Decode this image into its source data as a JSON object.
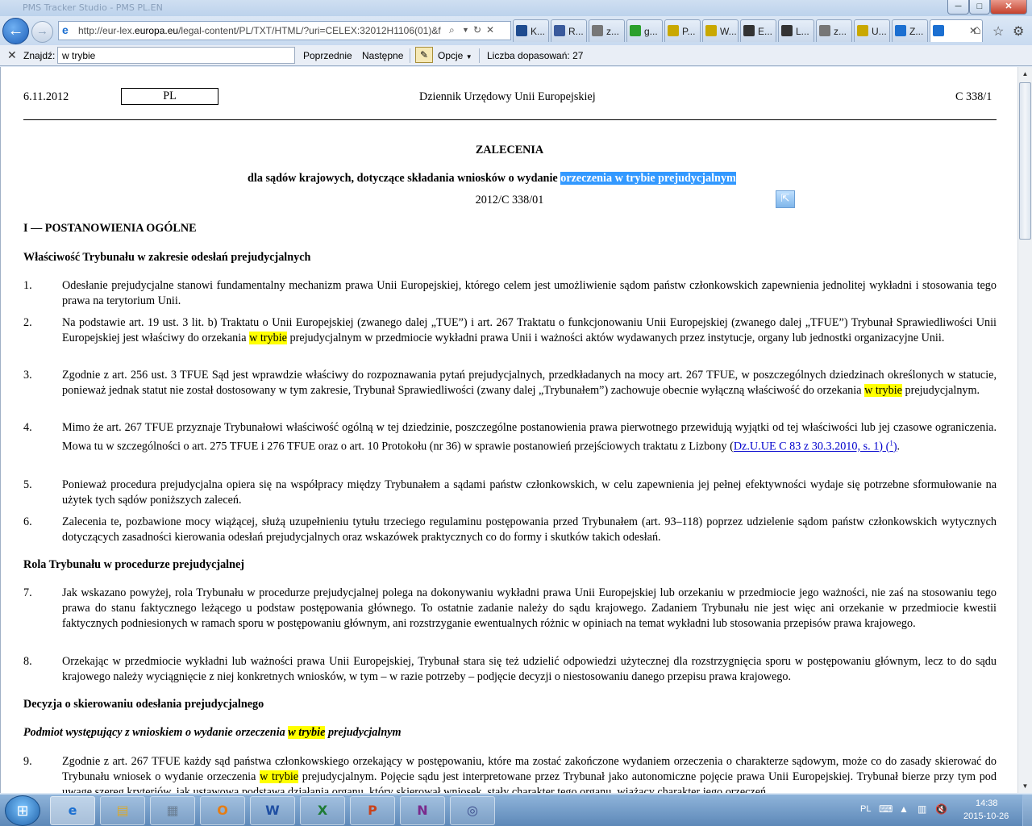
{
  "window": {
    "title": "PMS Tracker Studio - PMS PL.EN",
    "minimize": "─",
    "maximize": "□",
    "close": "✕"
  },
  "nav": {
    "back_icon": "←",
    "forward_icon": "→",
    "address": "http://eur-lex.europa.eu/legal-content/PL/TXT/HTML/?uri=CELEX:32012H1106(01)&f",
    "address_domain": "europa.eu",
    "tabs": [
      {
        "label": "K...",
        "icon_color": "#1e4b8f"
      },
      {
        "label": "R...",
        "icon_color": "#3a5a9c"
      },
      {
        "label": "z...",
        "icon_color": "#777777"
      },
      {
        "label": "g...",
        "icon_color": "#2ca02c"
      },
      {
        "label": "P...",
        "icon_color": "#c9a800"
      },
      {
        "label": "W...",
        "icon_color": "#c9a800"
      },
      {
        "label": "E...",
        "icon_color": "#333333"
      },
      {
        "label": "L...",
        "icon_color": "#333333"
      },
      {
        "label": "z...",
        "icon_color": "#777777"
      },
      {
        "label": "U...",
        "icon_color": "#c9a800"
      },
      {
        "label": "Z...",
        "icon_color": "#1b6fd1"
      },
      {
        "label": "",
        "icon_color": "#1b6fd1"
      }
    ],
    "home_icon": "⌂",
    "favorites_icon": "☆",
    "tools_icon": "⚙"
  },
  "findbar": {
    "close_icon": "✕",
    "label": "Znajdź:",
    "query": "w trybie",
    "prev": "Poprzednie",
    "next": "Następne",
    "options": "Opcje",
    "matches": "Liczba dopasowań: 27"
  },
  "doc": {
    "date": "6.11.2012",
    "lang": "PL",
    "journal": "Dziennik Urzędowy Unii Europejskiej",
    "number": "C 338/1",
    "title": "ZALECENIA",
    "subtitle_plain": "dla sądów krajowych, dotyczące składania wniosków o wydanie ",
    "subtitle_highlight": "orzeczenia w trybie prejudycjalnym",
    "ref": "2012/C 338/01",
    "section_i": "I —   POSTANOWIENIA OGÓLNE",
    "sub1": "Właściwość Trybunału w zakresie odesłań prejudycjalnych",
    "p1": "Odesłanie prejudycjalne stanowi fundamentalny mechanizm prawa Unii Europejskiej, którego celem jest umożliwienie sądom państw członkowskich zapewnienia jednolitej wykładni i stosowania tego prawa na terytorium Unii.",
    "p2a": "Na podstawie art. 19 ust. 3 lit. b) Traktatu o Unii Europejskiej (zwanego dalej „TUE”) i art. 267 Traktatu o funkcjonowaniu Unii Europejskiej (zwanego dalej „TFUE”) Trybunał Sprawiedliwości Unii Europejskiej jest właściwy do orzekania ",
    "p2hl": "w trybie",
    "p2b": " prejudycjalnym w przedmiocie wykładni prawa Unii i ważności aktów wydawanych przez instytucje, organy lub jednostki organizacyjne Unii.",
    "p3a": "Zgodnie z art. 256 ust. 3 TFUE Sąd jest wprawdzie właściwy do rozpoznawania pytań prejudycjalnych, przedkładanych na mocy art. 267 TFUE, w poszczególnych dziedzinach określonych w statucie, ponieważ jednak statut nie został dostosowany w tym zakresie, Trybunał Sprawiedliwości (zwany dalej „Trybunałem”) zachowuje obecnie wyłączną właściwość do orzekania ",
    "p3hl": "w trybie",
    "p3b": " prejudycjalnym.",
    "p4a": "Mimo że art. 267 TFUE przyznaje Trybunałowi właściwość ogólną w tej dziedzinie, poszczególne postanowienia prawa pierwotnego przewidują wyjątki od tej właściwości lub jej czasowe ograniczenia. Mowa tu w szczególności o art. 275 TFUE i 276 TFUE oraz o art. 10 Protokołu (nr 36) w sprawie postanowień przejściowych traktatu z Lizbony (",
    "p4link": "Dz.U.UE C 83 z 30.3.2010, s. 1",
    "p4b": ") ",
    "p4note": "1",
    "p4c": ".",
    "p5": "Ponieważ procedura prejudycjalna opiera się na współpracy między Trybunałem a sądami państw członkowskich, w celu zapewnienia jej pełnej efektywności wydaje się potrzebne sformułowanie na użytek tych sądów poniższych zaleceń.",
    "p6": "Zalecenia te, pozbawione mocy wiążącej, służą uzupełnieniu tytułu trzeciego regulaminu postępowania przed Trybunałem (art. 93–118) poprzez udzielenie sądom państw członkowskich wytycznych dotyczących zasadności kierowania odesłań prejudycjalnych oraz wskazówek praktycznych co do formy i skutków takich odesłań.",
    "sub2": "Rola Trybunału w procedurze prejudycjalnej",
    "p7": "Jak wskazano powyżej, rola Trybunału w procedurze prejudycjalnej polega na dokonywaniu wykładni prawa Unii Europejskiej lub orzekaniu w przedmiocie jego ważności, nie zaś na stosowaniu tego prawa do stanu faktycznego leżącego u podstaw postępowania głównego. To ostatnie zadanie należy do sądu krajowego. Zadaniem Trybunału nie jest więc ani orzekanie w przedmiocie kwestii faktycznych podniesionych w ramach sporu w postępowaniu głównym, ani rozstrzyganie ewentualnych różnic w opiniach na temat wykładni lub stosowania przepisów prawa krajowego.",
    "p8": "Orzekając w przedmiocie wykładni lub ważności prawa Unii Europejskiej, Trybunał stara się też udzielić odpowiedzi użytecznej dla rozstrzygnięcia sporu w postępowaniu głównym, lecz to do sądu krajowego należy wyciągnięcie z niej konkretnych wniosków, w tym – w razie potrzeby – podjęcie decyzji o niestosowaniu danego przepisu prawa krajowego.",
    "sub3": "Decyzja o skierowaniu odesłania prejudycjalnego",
    "sub4a": "Podmiot występujący z wnioskiem o wydanie orzeczenia ",
    "sub4hl": "w trybie",
    "sub4b": " prejudycjalnym",
    "p9a": "Zgodnie z art. 267 TFUE każdy sąd państwa członkowskiego orzekający w postępowaniu, które ma zostać zakończone wydaniem orzeczenia o charakterze sądowym, może co do zasady skierować do Trybunału wniosek o wydanie orzeczenia ",
    "p9hl": "w trybie",
    "p9b": " prejudycjalnym. Pojęcie sądu jest interpretowane przez Trybunał jako autonomiczne pojęcie prawa Unii Europejskiej. Trybunał bierze przy tym pod uwagę szereg kryteriów, jak ustawowa podstawa działania organu, który skierował wniosek, stały charakter tego organu, wiążący charakter jego orzeczeń",
    "nums": [
      "1.",
      "2.",
      "3.",
      "4.",
      "5.",
      "6.",
      "7.",
      "8.",
      "9."
    ]
  },
  "taskbar": {
    "start_icon": "⊞",
    "apps": [
      {
        "name": "ie",
        "glyph": "e",
        "color": "#1b6fd1"
      },
      {
        "name": "explorer",
        "glyph": "▤",
        "color": "#d8a930"
      },
      {
        "name": "calculator",
        "glyph": "▦",
        "color": "#6b7f95"
      },
      {
        "name": "outlook",
        "glyph": "O",
        "color": "#e47d16"
      },
      {
        "name": "word",
        "glyph": "W",
        "color": "#1f4fa3"
      },
      {
        "name": "excel",
        "glyph": "X",
        "color": "#1e7b34"
      },
      {
        "name": "powerpoint",
        "glyph": "P",
        "color": "#c9421b"
      },
      {
        "name": "onenote",
        "glyph": "N",
        "color": "#7a2a8c"
      },
      {
        "name": "vpn",
        "glyph": "◎",
        "color": "#3a4a8a"
      }
    ],
    "lang": "PL",
    "time": "14:38",
    "date": "2015-10-26"
  }
}
